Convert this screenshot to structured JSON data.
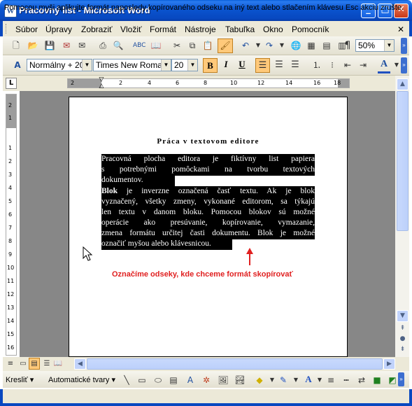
{
  "window": {
    "title": "Pracovný list - Microsoft Word",
    "app_icon": "W"
  },
  "menu": [
    "Súbor",
    "Úpravy",
    "Zobraziť",
    "Vložiť",
    "Formát",
    "Nástroje",
    "Tabuľka",
    "Okno",
    "Pomocník"
  ],
  "standard_toolbar": {
    "zoom": "50%"
  },
  "formatting_toolbar": {
    "style": "Normálny + 20",
    "font": "Times New Roman",
    "size": "20"
  },
  "drawing_toolbar": {
    "draw_label": "Kresliť",
    "autoshapes_label": "Automatické tvary"
  },
  "ruler": {
    "h_labels": [
      "2",
      "2",
      "4",
      "6",
      "8",
      "10",
      "12",
      "14",
      "16",
      "18"
    ],
    "v_labels": [
      "2",
      "1",
      "1",
      "2",
      "3",
      "4",
      "5",
      "6",
      "7",
      "8",
      "9",
      "10",
      "11",
      "12",
      "13",
      "14",
      "15",
      "16"
    ]
  },
  "document": {
    "title": "Práca v textovom editore",
    "paragraph1": [
      "Pracovná plocha editora je fiktívny list papiera",
      "s potrebnými pomôckami na tvorbu textových",
      "dokumentov."
    ],
    "paragraph2_first_bold": "Blok",
    "paragraph2": [
      " je inverzne označená časť textu. Ak je blok",
      "vyznačený, všetky zmeny, vykonané editorom, sa týkajú",
      "len textu v danom bloku. Pomocou blokov sú možné",
      "operácie ako presúvanie, kopírovanie, vymazanie,",
      "zmena formátu určitej časti dokumentu. Blok je možné",
      "označiť myšou alebo klávesnicou."
    ]
  },
  "annotation": "Označíme odseky, kde chceme formát skopírovať",
  "status_bar": "Pomocou myši aplikujte formát naposledy kopírovaného odseku na iný text alebo stlačením klávesu Esc akciu zrušte.",
  "colors": {
    "title_bar": "#0a5fd8",
    "annotation": "#e02020",
    "selection": "#000000",
    "doc_background": "#878787"
  }
}
